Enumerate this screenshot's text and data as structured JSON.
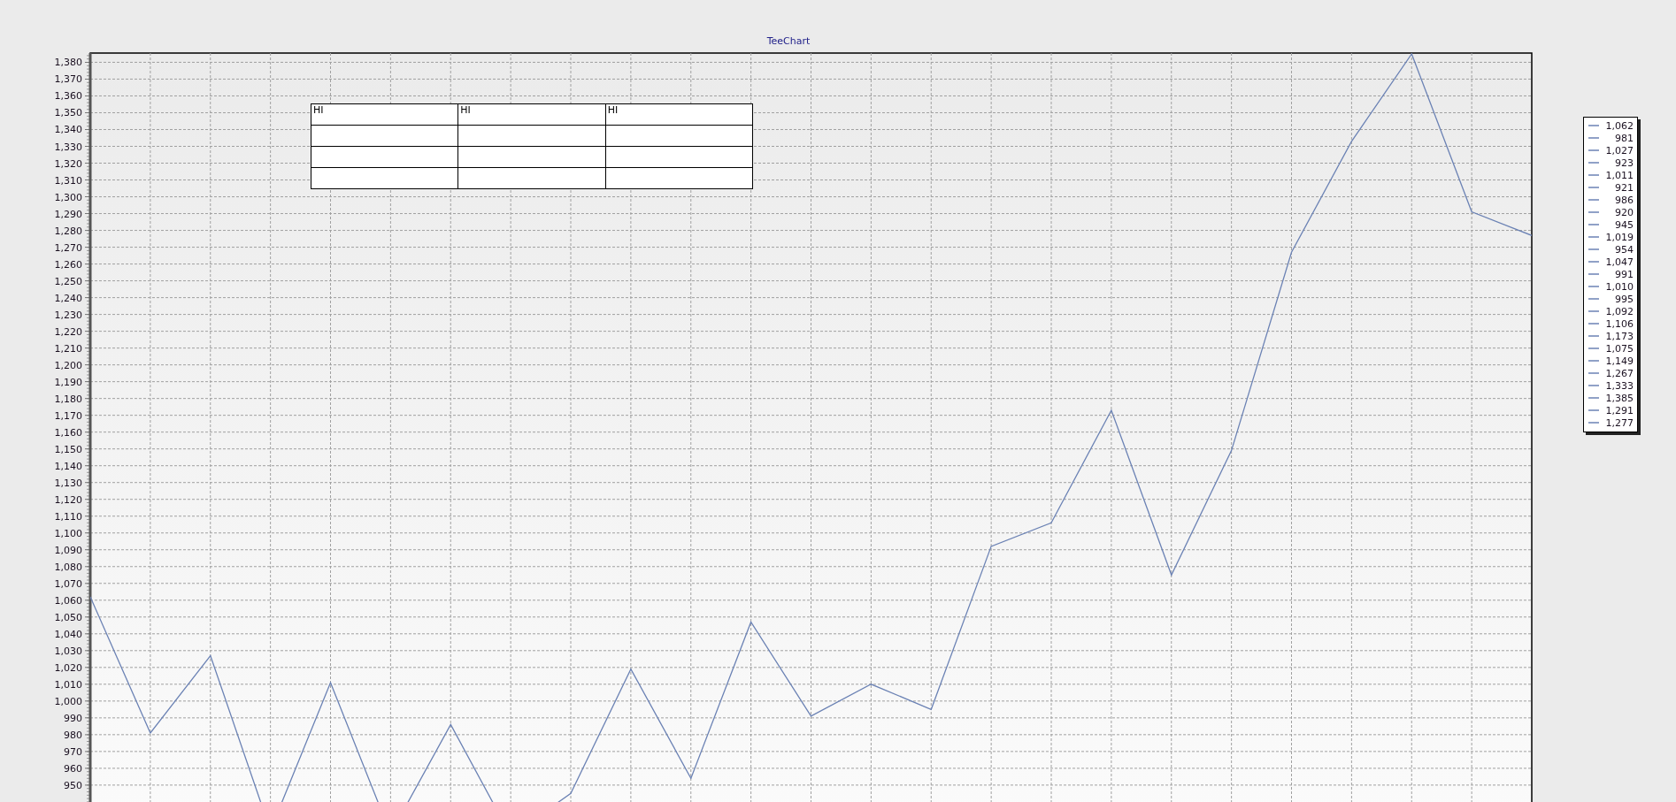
{
  "chart": {
    "chart_data": {
      "type": "line",
      "title": "TeeChart",
      "grid": true,
      "categories": [
        null,
        null,
        null,
        null,
        null,
        null,
        null,
        null,
        null,
        null,
        null,
        null,
        null,
        null,
        null,
        null,
        null,
        null,
        null,
        null,
        null,
        null,
        null,
        null,
        null
      ],
      "series": [
        {
          "color": "#6b82b4",
          "values": [
            1062,
            981,
            1027,
            923,
            1011,
            921,
            986,
            920,
            945,
            1019,
            954,
            1047,
            991,
            1010,
            995,
            1092,
            1106,
            1173,
            1075,
            1149,
            1267,
            1333,
            1385,
            1291,
            1277
          ]
        }
      ],
      "ylim": [
        920,
        1385.5
      ],
      "yticks": [
        950,
        960,
        970,
        980,
        990,
        {
          "value": 1000,
          "label": "1,000"
        },
        {
          "value": 1010,
          "label": "1,010"
        },
        {
          "value": 1020,
          "label": "1,020"
        },
        {
          "value": 1030,
          "label": "1,030"
        },
        {
          "value": 1040,
          "label": "1,040"
        },
        {
          "value": 1050,
          "label": "1,050"
        },
        {
          "value": 1060,
          "label": "1,060"
        },
        {
          "value": 1070,
          "label": "1,070"
        },
        {
          "value": 1080,
          "label": "1,080"
        },
        {
          "value": 1090,
          "label": "1,090"
        },
        {
          "value": 1100,
          "label": "1,100"
        },
        {
          "value": 1110,
          "label": "1,110"
        },
        {
          "value": 1120,
          "label": "1,120"
        },
        {
          "value": 1130,
          "label": "1,130"
        },
        {
          "value": 1140,
          "label": "1,140"
        },
        {
          "value": 1150,
          "label": "1,150"
        },
        {
          "value": 1160,
          "label": "1,160"
        },
        {
          "value": 1170,
          "label": "1,170"
        },
        {
          "value": 1180,
          "label": "1,180"
        },
        {
          "value": 1190,
          "label": "1,190"
        },
        {
          "value": 1200,
          "label": "1,200"
        },
        {
          "value": 1210,
          "label": "1,210"
        },
        {
          "value": 1220,
          "label": "1,220"
        },
        {
          "value": 1230,
          "label": "1,230"
        },
        {
          "value": 1240,
          "label": "1,240"
        },
        {
          "value": 1250,
          "label": "1,250"
        },
        {
          "value": 1260,
          "label": "1,260"
        },
        {
          "value": 1270,
          "label": "1,270"
        },
        {
          "value": 1280,
          "label": "1,280"
        },
        {
          "value": 1290,
          "label": "1,290"
        },
        {
          "value": 1300,
          "label": "1,300"
        },
        {
          "value": 1310,
          "label": "1,310"
        },
        {
          "value": 1320,
          "label": "1,320"
        },
        {
          "value": 1330,
          "label": "1,330"
        },
        {
          "value": 1340,
          "label": "1,340"
        },
        {
          "value": 1350,
          "label": "1,350"
        },
        {
          "value": 1360,
          "label": "1,360"
        },
        {
          "value": 1370,
          "label": "1,370"
        },
        {
          "value": 1380,
          "label": "1,380"
        }
      ]
    }
  },
  "table": {
    "columns": [
      "HI",
      "HI",
      "HI"
    ]
  },
  "legend": [
    "1,062",
    "981",
    "1,027",
    "923",
    "1,011",
    "921",
    "986",
    "920",
    "945",
    "1,019",
    "954",
    "1,047",
    "991",
    "1,010",
    "995",
    "1,092",
    "1,106",
    "1,173",
    "1,075",
    "1,149",
    "1,267",
    "1,333",
    "1,385",
    "1,291",
    "1,277"
  ]
}
